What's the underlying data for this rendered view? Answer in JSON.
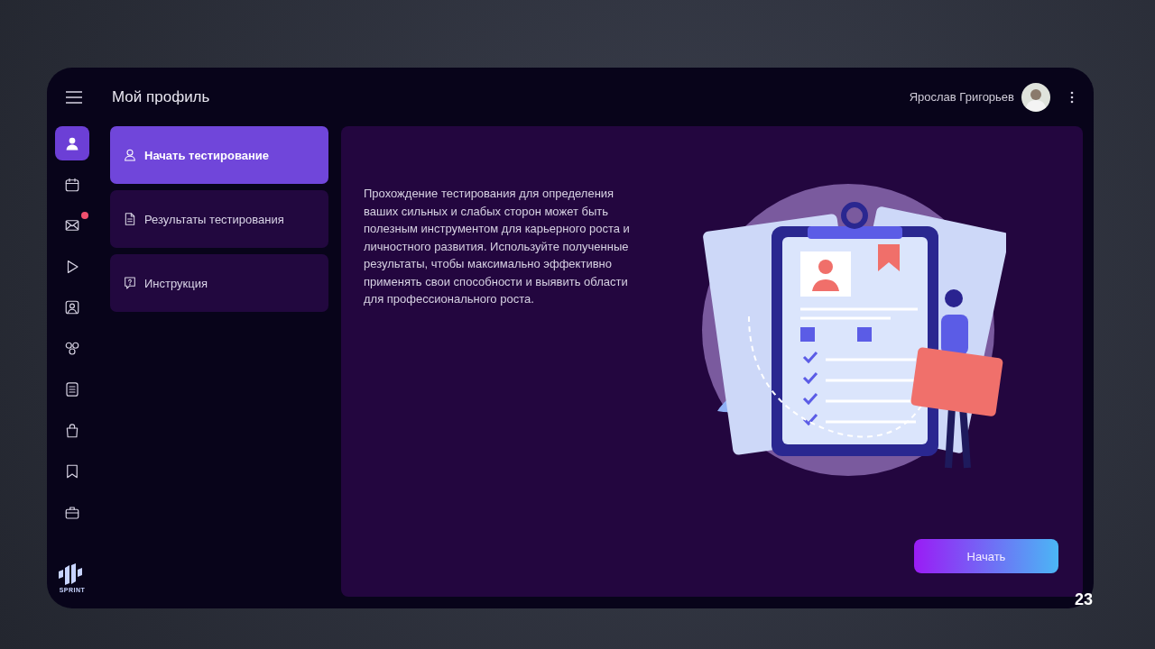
{
  "header": {
    "title": "Мой профиль",
    "user_name": "Ярослав Григорьев"
  },
  "rail": [
    {
      "kind": "user",
      "selected": true,
      "badge": false
    },
    {
      "kind": "calendar",
      "selected": false,
      "badge": false
    },
    {
      "kind": "mail",
      "selected": false,
      "badge": true
    },
    {
      "kind": "play",
      "selected": false,
      "badge": false
    },
    {
      "kind": "contact",
      "selected": false,
      "badge": false
    },
    {
      "kind": "circles",
      "selected": false,
      "badge": false
    },
    {
      "kind": "notes",
      "selected": false,
      "badge": false
    },
    {
      "kind": "bag",
      "selected": false,
      "badge": false
    },
    {
      "kind": "bookmark",
      "selected": false,
      "badge": false
    },
    {
      "kind": "briefcase",
      "selected": false,
      "badge": false
    }
  ],
  "logo": {
    "text": "SPRINT"
  },
  "menu": [
    {
      "kind": "start",
      "label": "Начать тестирование",
      "selected": true
    },
    {
      "kind": "results",
      "label": "Результаты тестирования",
      "selected": false
    },
    {
      "kind": "instructions",
      "label": "Инструкция",
      "selected": false
    }
  ],
  "content": {
    "description": "Прохождение тестирования для определения ваших сильных и слабых сторон может быть полезным инструментом для карьерного роста и личностного развития. Используйте полученные результаты, чтобы максимально эффективно применять свои способности и выявить области для профессионального роста.",
    "button": "Начать"
  },
  "slide_number": "23"
}
